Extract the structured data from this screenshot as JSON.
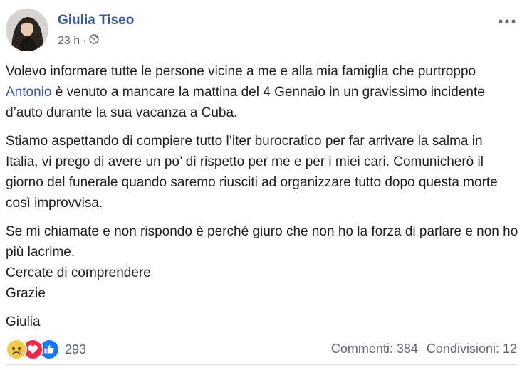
{
  "post": {
    "author": "Giulia Tiseo",
    "time": "23 h",
    "separator": "·",
    "privacy_icon": "globe-icon",
    "menu_icon": "more-options-icon",
    "paragraphs": [
      {
        "before": "Volevo informare tutte le persone vicine a me e alla mia famiglia che purtroppo ",
        "mention": "Antonio",
        "after": " è venuto a mancare la mattina del 4 Gennaio in un gravissimo incidente d’auto durante la sua vacanza a Cuba."
      }
    ],
    "p2": "Stiamo aspettando di compiere tutto l’iter burocratico per far arrivare la salma in Italia, vi prego di avere un po’ di rispetto per me e per i miei cari. Comunicherò il giorno del funerale quando saremo riusciti ad organizzare tutto dopo questa morte così improvvisa.",
    "p3_line1": "Se mi chiamate e non rispondo è perché giuro che non ho la forza di parlare e non ho più lacrime.",
    "p3_line2": "Cercate di comprendere",
    "p3_line3": "Grazie",
    "signature": "Giulia"
  },
  "footer": {
    "reactions": [
      "sad-reaction-icon",
      "love-reaction-icon",
      "like-reaction-icon"
    ],
    "reaction_count": "293",
    "comments": "Commenti: 384",
    "shares": "Condivisioni: 12"
  },
  "colors": {
    "link": "#385898",
    "meta": "#606770",
    "text": "#1c1e21"
  }
}
